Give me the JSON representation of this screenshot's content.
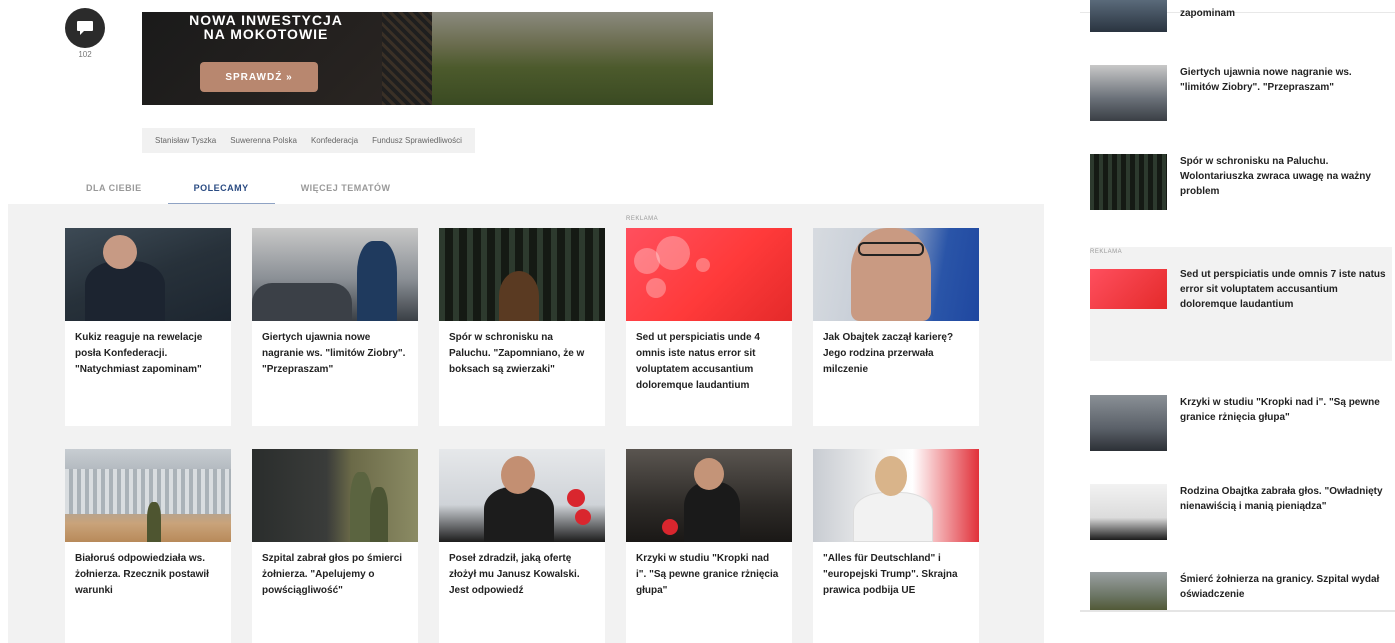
{
  "comments": {
    "count": "102"
  },
  "banner": {
    "line1": "NOWA INWESTYCJA",
    "line2": "NA MOKOTOWIE",
    "cta": "SPRAWDŹ »"
  },
  "tags": [
    "Stanisław Tyszka",
    "Suwerenna Polska",
    "Konfederacja",
    "Fundusz Sprawiedliwości"
  ],
  "tabs": [
    "DLA CIEBIE",
    "POLECAMY",
    "WIĘCEJ TEMATÓW"
  ],
  "ad_label": "REKLAMA",
  "cards": [
    {
      "title": "Kukiz reaguje na rewelacje posła Konfederacji. \"Natychmiast zapominam\""
    },
    {
      "title": "Giertych ujawnia nowe nagranie ws. \"limitów Ziobry\". \"Przepraszam\""
    },
    {
      "title": "Spór w schronisku na Paluchu. \"Zapomniano, że w boksach są zwierzaki\""
    },
    {
      "title": "Sed ut perspiciatis unde 4 omnis iste natus error sit voluptatem accusantium doloremque laudantium"
    },
    {
      "title": "Jak Obajtek zaczął karierę? Jego rodzina przerwała milczenie"
    },
    {
      "title": "Białoruś odpowiedziała ws. żołnierza. Rzecznik postawił warunki"
    },
    {
      "title": "Szpital zabrał głos po śmierci żołnierza. \"Apelujemy o powściągliwość\""
    },
    {
      "title": "Poseł zdradził, jaką ofertę złożył mu Janusz Kowalski. Jest odpowiedź"
    },
    {
      "title": "Krzyki w studiu \"Kropki nad i\". \"Są pewne granice rżnięcia głupa\""
    },
    {
      "title": "\"Alles für Deutschland\" i \"europejski Trump\". Skrajna prawica podbija UE"
    }
  ],
  "sidebar": [
    {
      "title": "zapominam"
    },
    {
      "title": "Giertych ujawnia nowe nagranie ws. \"limitów Ziobry\". \"Przepraszam\""
    },
    {
      "title": "Spór w schronisku na Paluchu. Wolontariuszka zwraca uwagę na ważny problem"
    },
    {
      "title": "Sed ut perspiciatis unde omnis 7 iste natus error sit voluptatem accusantium doloremque laudantium"
    },
    {
      "title": "Krzyki w studiu \"Kropki nad i\". \"Są pewne granice rżnięcia głupa\""
    },
    {
      "title": "Rodzina Obajtka zabrała głos. \"Owładnięty nienawiścią i manią pieniądza\""
    },
    {
      "title": "Śmierć żołnierza na granicy. Szpital wydał oświadczenie"
    }
  ]
}
